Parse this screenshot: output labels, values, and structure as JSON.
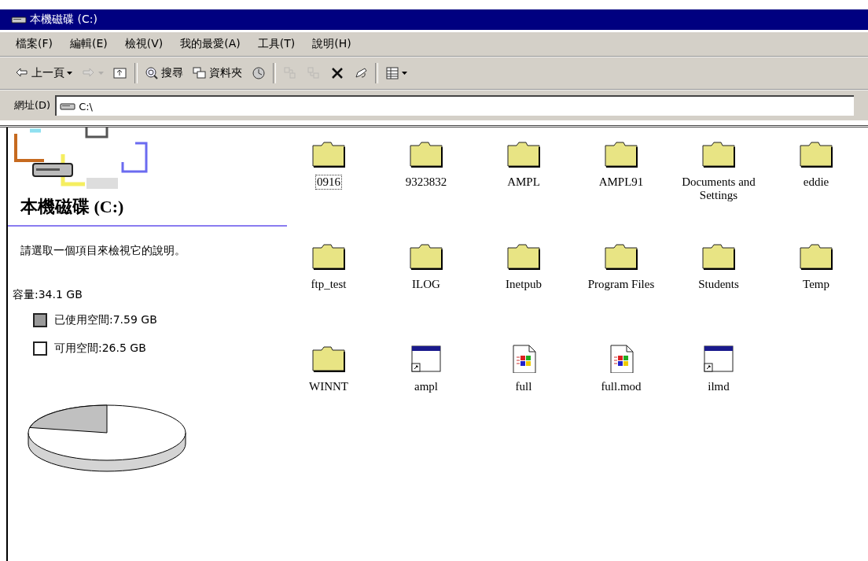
{
  "window": {
    "title": "本機磁碟 (C:)"
  },
  "menu": [
    "檔案(F)",
    "編輯(E)",
    "檢視(V)",
    "我的最愛(A)",
    "工具(T)",
    "說明(H)"
  ],
  "toolbar": [
    {
      "kind": "back",
      "label": "上一頁",
      "disabled": false
    },
    {
      "kind": "forward",
      "disabled": true
    },
    {
      "kind": "up",
      "disabled": false
    },
    {
      "kind": "sep"
    },
    {
      "kind": "search",
      "label": "搜尋",
      "disabled": false
    },
    {
      "kind": "folders",
      "label": "資料夾",
      "disabled": false
    },
    {
      "kind": "history",
      "disabled": false
    },
    {
      "kind": "sep"
    },
    {
      "kind": "moveto",
      "disabled": true
    },
    {
      "kind": "copyto",
      "disabled": true
    },
    {
      "kind": "delete",
      "disabled": false
    },
    {
      "kind": "undo",
      "disabled": false
    },
    {
      "kind": "sep"
    },
    {
      "kind": "views",
      "disabled": false
    }
  ],
  "address": {
    "label": "網址(D)",
    "value": "C:\\"
  },
  "info_panel": {
    "title": "本機磁碟 (C:)",
    "hint": "請選取一個項目來檢視它的說明。",
    "capacity": "容量:34.1 GB",
    "legend": [
      {
        "label": "已使用空間:7.59 GB",
        "kind": "used"
      },
      {
        "label": "可用空間:26.5 GB",
        "kind": "free"
      }
    ],
    "usage": {
      "level": 0.22
    }
  },
  "files": [
    {
      "name": "0916",
      "kind": "folder",
      "focused": true
    },
    {
      "name": "9323832",
      "kind": "folder",
      "focused": false
    },
    {
      "name": "AMPL",
      "kind": "folder",
      "focused": false
    },
    {
      "name": "AMPL91",
      "kind": "folder",
      "focused": false
    },
    {
      "name": "Documents and Settings",
      "kind": "folder",
      "focused": false
    },
    {
      "name": "eddie",
      "kind": "folder",
      "focused": false
    },
    {
      "name": "ftp_test",
      "kind": "folder",
      "focused": false
    },
    {
      "name": "ILOG",
      "kind": "folder",
      "focused": false
    },
    {
      "name": "Inetpub",
      "kind": "folder",
      "focused": false
    },
    {
      "name": "Program Files",
      "kind": "folder",
      "focused": false
    },
    {
      "name": "Students",
      "kind": "folder",
      "focused": false
    },
    {
      "name": "Temp",
      "kind": "folder",
      "focused": false
    },
    {
      "name": "WINNT",
      "kind": "folder",
      "focused": false
    },
    {
      "name": "ampl",
      "kind": "shortcut",
      "focused": false
    },
    {
      "name": "full",
      "kind": "modfile",
      "focused": false
    },
    {
      "name": "full.mod",
      "kind": "modfile",
      "focused": false
    },
    {
      "name": "ilmd",
      "kind": "shortcut",
      "focused": false
    }
  ]
}
